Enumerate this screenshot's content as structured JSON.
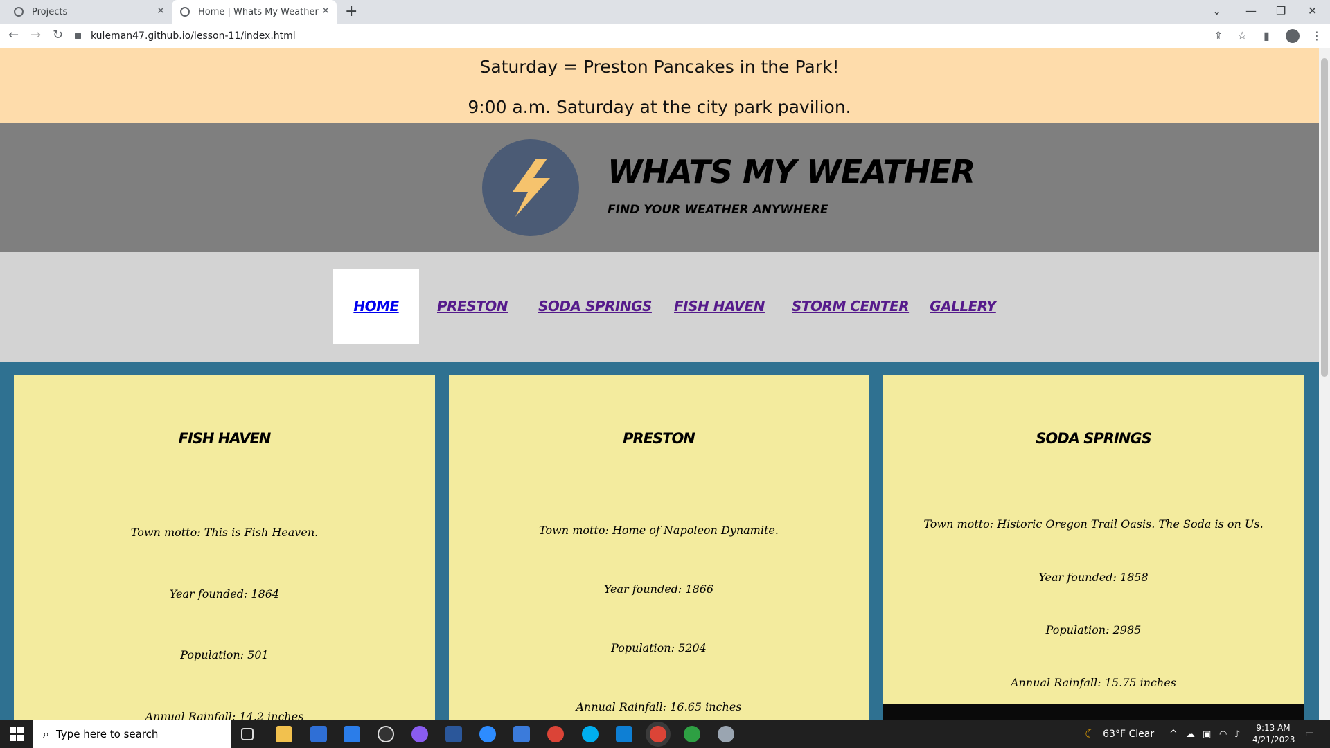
{
  "browser": {
    "tabs": [
      {
        "title": "Projects"
      },
      {
        "title": "Home | Whats My Weather"
      }
    ],
    "url": "kuleman47.github.io/lesson-11/index.html"
  },
  "page": {
    "banner": {
      "line1": "Saturday = Preston Pancakes in the Park!",
      "line2": "9:00 a.m. Saturday at the city park pavilion."
    },
    "header": {
      "title": "WHATS MY WEATHER",
      "subtitle": "FIND YOUR WEATHER ANYWHERE"
    },
    "nav": [
      {
        "label": "HOME",
        "active": true
      },
      {
        "label": "PRESTON"
      },
      {
        "label": "SODA SPRINGS"
      },
      {
        "label": "FISH HAVEN"
      },
      {
        "label": "STORM CENTER"
      },
      {
        "label": "GALLERY"
      }
    ],
    "towns": [
      {
        "name": "FISH HAVEN",
        "motto": "Town motto: This is Fish Heaven.",
        "founded": "Year founded: 1864",
        "population": "Population: 501",
        "rainfall": "Annual Rainfall: 14.2 inches"
      },
      {
        "name": "PRESTON",
        "motto": "Town motto: Home of Napoleon Dynamite.",
        "founded": "Year founded: 1866",
        "population": "Population: 5204",
        "rainfall": "Annual Rainfall: 16.65 inches"
      },
      {
        "name": "SODA SPRINGS",
        "motto": "Town motto: Historic Oregon Trail Oasis. The Soda is on Us.",
        "founded": "Year founded: 1858",
        "population": "Population: 2985",
        "rainfall": "Annual Rainfall: 15.75 inches"
      }
    ]
  },
  "taskbar": {
    "search_placeholder": "Type here to search",
    "weather": "63°F  Clear",
    "time": "9:13 AM",
    "date": "4/21/2023"
  },
  "colors": {
    "banner": "#fedcab",
    "header": "#7f7f7f",
    "nav": "#d3d3d3",
    "main": "#2f7191",
    "card": "#f3eb9e",
    "logo_circle": "#4b5b75",
    "bolt": "#f6c36d"
  }
}
